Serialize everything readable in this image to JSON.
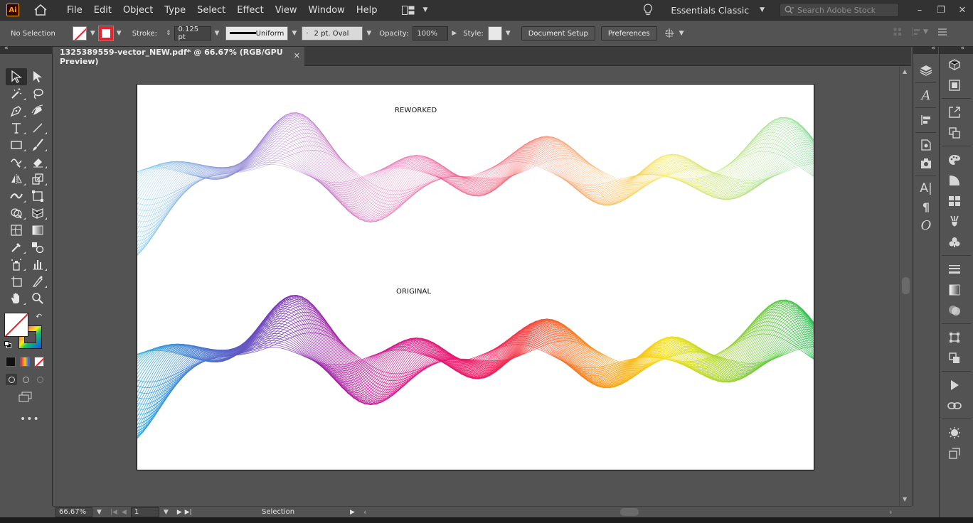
{
  "menubar": {
    "logo": "Ai",
    "items": [
      "File",
      "Edit",
      "Object",
      "Type",
      "Select",
      "Effect",
      "View",
      "Window",
      "Help"
    ],
    "workspace": "Essentials Classic",
    "search_placeholder": "Search Adobe Stock"
  },
  "controlbar": {
    "selection_label": "No Selection",
    "stroke_label": "Stroke:",
    "stroke_weight": "0.125 pt",
    "profile": "Uniform",
    "brush": "2 pt. Oval",
    "opacity_label": "Opacity:",
    "opacity_value": "100%",
    "style_label": "Style:",
    "document_setup": "Document Setup",
    "preferences": "Preferences"
  },
  "document": {
    "tab_title": "1325389559-vector_NEW.pdf* @ 66.67% (RGB/GPU Preview)"
  },
  "artboard": {
    "label_top": "REWORKED",
    "label_bottom": "ORIGINAL"
  },
  "statusbar": {
    "zoom": "66.67%",
    "artboard_number": "1",
    "tool_status": "Selection"
  },
  "colors": {
    "app_bg": "#535353",
    "menubar_bg": "#323232",
    "accent_red": "#e5232a",
    "logo_orange": "#ff9a00"
  },
  "icons": {
    "left_tools": [
      "selection-tool-icon",
      "direct-selection-tool-icon",
      "magic-wand-icon",
      "lasso-icon",
      "pen-tool-icon",
      "curvature-tool-icon",
      "type-tool-icon",
      "line-tool-icon",
      "rectangle-tool-icon",
      "paintbrush-icon",
      "shaper-tool-icon",
      "eraser-icon",
      "rotate-tool-icon",
      "scale-tool-icon",
      "width-tool-icon",
      "free-transform-icon",
      "shape-builder-icon",
      "perspective-grid-icon",
      "mesh-tool-icon",
      "gradient-tool-icon",
      "eyedropper-icon",
      "blend-tool-icon",
      "symbol-sprayer-icon",
      "column-graph-icon",
      "artboard-tool-icon",
      "slice-tool-icon",
      "hand-tool-icon",
      "zoom-tool-icon"
    ]
  }
}
